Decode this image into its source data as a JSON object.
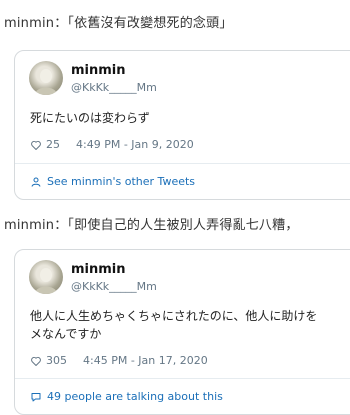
{
  "post1": {
    "caption": "minmin：「依舊沒有改變想死的念頭」",
    "tweet": {
      "name": "minmin",
      "handle": "@KkKk_____Mm",
      "text_line1": "死にたいのは変わらず",
      "likes": "25",
      "timestamp": "4:49 PM - Jan 9, 2020",
      "footer_link": "See minmin's other Tweets"
    }
  },
  "post2": {
    "caption": "minmin：「即使自己的人生被別人弄得亂七八糟，",
    "tweet": {
      "name": "minmin",
      "handle": "@KkKk_____Mm",
      "text_line1": "他人に人生めちゃくちゃにされたのに、他人に助けを",
      "text_line2": "メなんですか",
      "likes": "305",
      "timestamp": "4:45 PM - Jan 17, 2020",
      "footer_link": "49 people are talking about this"
    }
  },
  "icons": {
    "heart": "heart-icon",
    "person": "person-icon",
    "comment": "comment-icon"
  },
  "colors": {
    "link": "#1b6fb8",
    "muted": "#657786",
    "border": "#d6dadd"
  }
}
